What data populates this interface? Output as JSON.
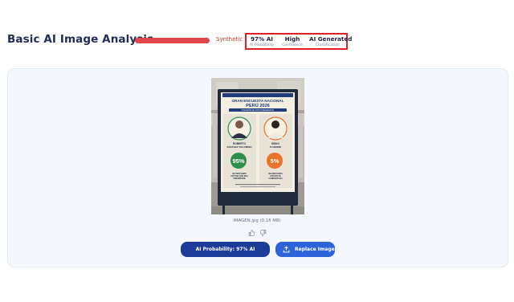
{
  "header": {
    "title": "Basic AI Image Analysis",
    "result_label": "Synthetic",
    "result_color": "#e0454c",
    "stats": [
      {
        "value": "97% AI",
        "label": "AI Probability"
      },
      {
        "value": "High",
        "label": "Confidence"
      },
      {
        "value": "AI Generated",
        "label": "Classification"
      }
    ]
  },
  "poster": {
    "heading_1": "GRAN ENCUESTA NACIONAL",
    "heading_2": "PERÚ 2026",
    "subheading": "INTENCIÓN DE VOTO PRESIDENCIAL",
    "candidates": [
      {
        "name_1": "ROBERTO",
        "name_2": "SÁNCHEZ PALOMINO",
        "percent": "95%",
        "caption_1": "DE PERUANOS",
        "caption_2": "APOYAN QUE SEA",
        "caption_3": "PRESIDENTE",
        "color": "#2f8f4a"
      },
      {
        "name_1": "KEIKO",
        "name_2": "FUJIMORI",
        "percent": "5%",
        "caption_1": "DE PERUANOS",
        "caption_2": "APOYAN SU",
        "caption_3": "CANDIDATURA",
        "color": "#e8732a"
      }
    ]
  },
  "file": {
    "name": "IMAGEN.jpg (0.16 MB)"
  },
  "feedback": {
    "like_icon": "thumbs-up-icon",
    "dislike_icon": "thumbs-down-icon"
  },
  "actions": {
    "probability_button": "AI Probability: 97% AI",
    "replace_button": "Replace Image",
    "primary_color": "#1c3c9a",
    "secondary_color": "#2f63d9"
  }
}
